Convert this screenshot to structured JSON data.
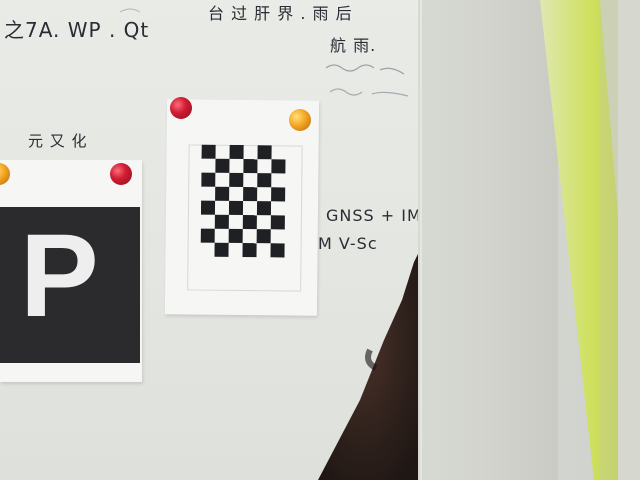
{
  "whiteboard": {
    "lines": [
      {
        "id": "top-left-note",
        "text": "之7A.  WP . Qt"
      },
      {
        "id": "top-right-note",
        "text": "台 过 肝 界 . 雨 后"
      },
      {
        "id": "right-note-1",
        "text": "航 雨."
      },
      {
        "id": "right-note-2",
        "text": "GNSS + IM"
      },
      {
        "id": "right-note-3",
        "text": "M  V-Sc"
      },
      {
        "id": "left-note",
        "text": "元 又 化"
      }
    ]
  },
  "signs": {
    "parking_letter": "P"
  },
  "checkerboard": {
    "rows": 8,
    "cols": 6
  },
  "colors": {
    "magnet_red": "#c81a31",
    "magnet_yellow": "#f0a52a",
    "parking_block": "#2b2b2e",
    "foreground_green": "#cfe05f"
  }
}
